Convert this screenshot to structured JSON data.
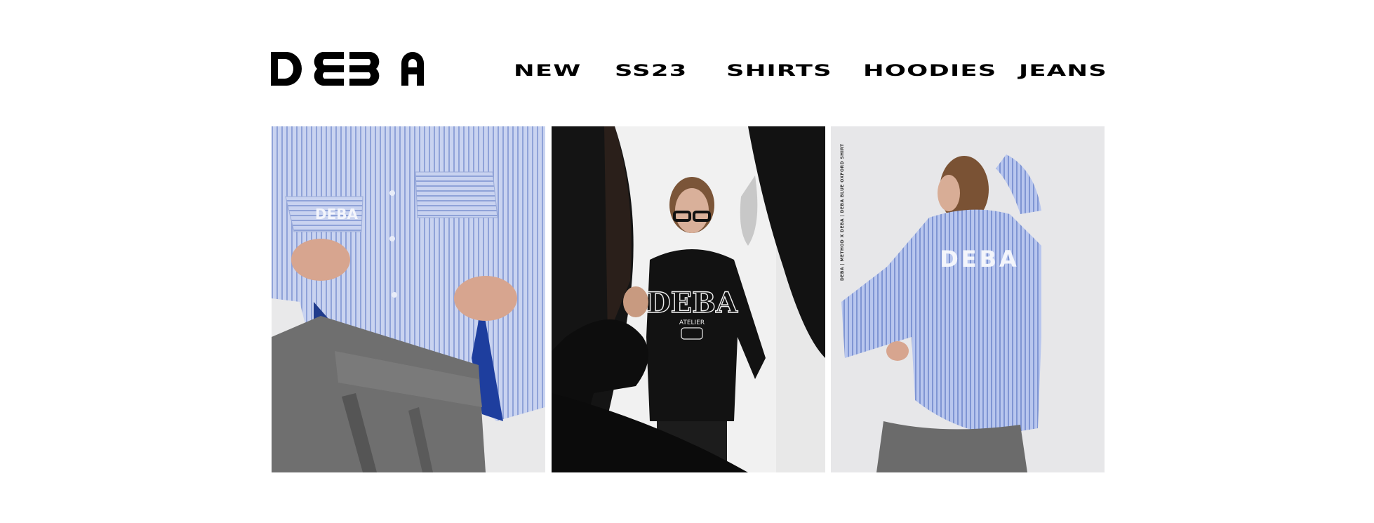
{
  "brand": {
    "logo_text": "DEBA"
  },
  "nav": {
    "items": [
      {
        "label": "NEW"
      },
      {
        "label": "SS23"
      },
      {
        "label": "SHIRTS"
      },
      {
        "label": "HOODIES"
      },
      {
        "label": "JEANS"
      }
    ]
  },
  "gallery": {
    "tiles": [
      {
        "subject": "model in blue striped oversized shirt and grey trousers",
        "shirt_print": "DEBA"
      },
      {
        "subject": "model in black DEBA Atelier sweatshirt and glasses",
        "sweatshirt_print": "DEBA",
        "sweatshirt_sub": "ATELIER"
      },
      {
        "subject": "model from behind in blue striped shirt",
        "shirt_print": "DEBA",
        "side_caption": "DEBA | METHOD X DEBA | DEBA BLUE OXFORD SHIRT"
      }
    ]
  },
  "colors": {
    "background": "#ffffff",
    "text": "#000000",
    "shirt_blue": "#aebde6",
    "trouser_grey": "#6f6f6f",
    "studio_grey": "#e6e6e6"
  }
}
